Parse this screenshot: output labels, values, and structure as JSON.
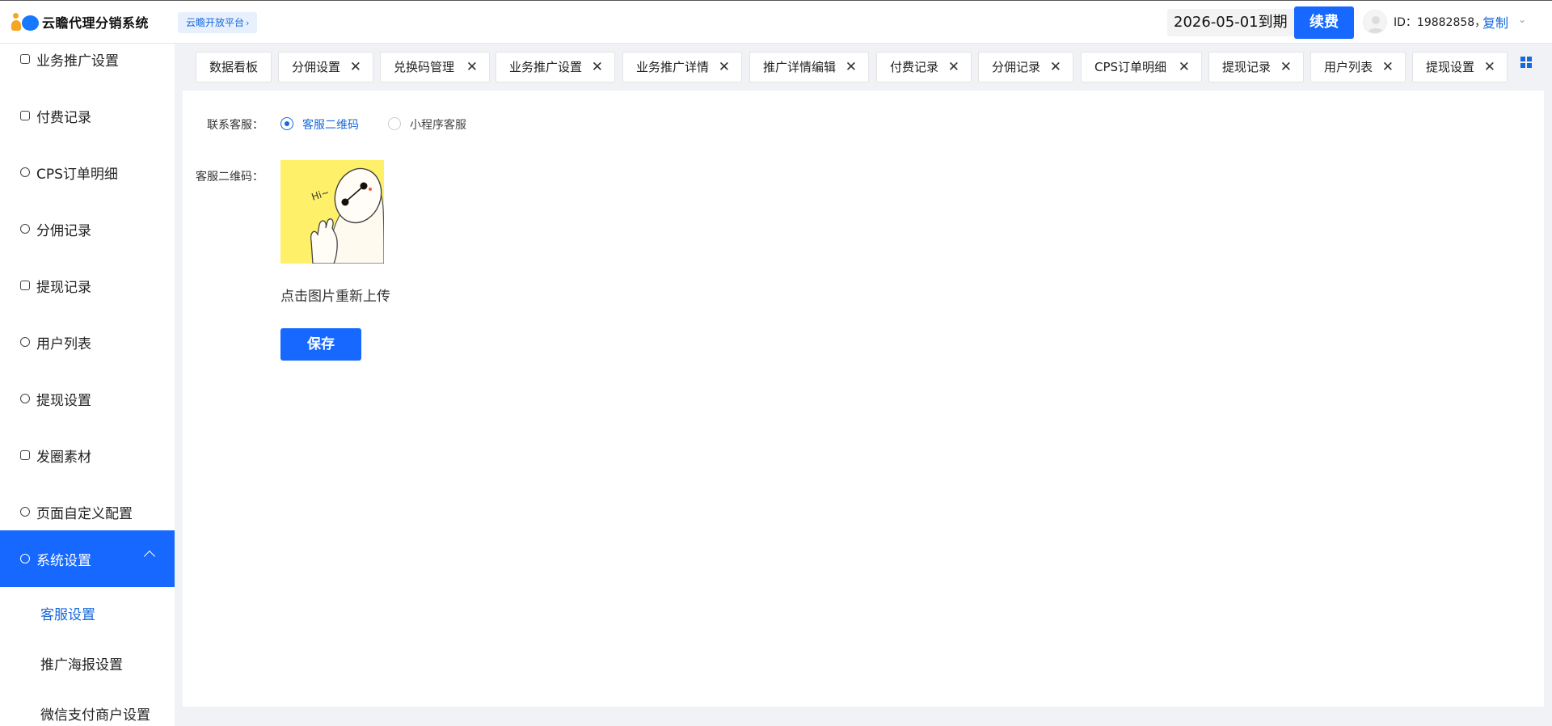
{
  "header": {
    "app_title": "云瞻代理分销系统",
    "platform_tag": "云瞻开放平台",
    "platform_chevron": "›",
    "expire_text": "2026-05-01到期",
    "renew_label": "续费",
    "uid_text": "ID：19882858，",
    "copy_label": "复制",
    "caret": "⌄"
  },
  "sidebar": {
    "items": [
      {
        "label": "业务推广设置"
      },
      {
        "label": "付费记录"
      },
      {
        "label": "CPS订单明细"
      },
      {
        "label": "分佣记录"
      },
      {
        "label": "提现记录"
      },
      {
        "label": "用户列表"
      },
      {
        "label": "提现设置"
      },
      {
        "label": "发圈素材"
      },
      {
        "label": "页面自定义配置"
      },
      {
        "label": "系统设置"
      }
    ],
    "sub_items": [
      {
        "label": "客服设置"
      },
      {
        "label": "推广海报设置"
      },
      {
        "label": "微信支付商户设置"
      }
    ]
  },
  "tabs": [
    {
      "label": "数据看板"
    },
    {
      "label": "分佣设置",
      "close": "✕"
    },
    {
      "label": "兑换码管理",
      "close": "✕"
    },
    {
      "label": "业务推广设置",
      "close": "✕"
    },
    {
      "label": "业务推广详情",
      "close": "✕"
    },
    {
      "label": "推广详情编辑",
      "close": "✕"
    },
    {
      "label": "付费记录",
      "close": "✕"
    },
    {
      "label": "分佣记录",
      "close": "✕"
    },
    {
      "label": "CPS订单明细",
      "close": "✕"
    },
    {
      "label": "提现记录",
      "close": "✕"
    },
    {
      "label": "用户列表",
      "close": "✕"
    },
    {
      "label": "提现设置",
      "close": "✕"
    }
  ],
  "form": {
    "contact_label": "联系客服：",
    "radio_qr_label": "客服二维码",
    "radio_mini_label": "小程序客服",
    "selected": "客服二维码",
    "qr_label": "客服二维码：",
    "qr_image_text": "Hi~",
    "upload_hint": "点击图片重新上传",
    "save_label": "保存"
  },
  "colors": {
    "primary": "#1668ff",
    "link": "#1668dc",
    "logo_orange": "#f5a623",
    "qr_bg": "#fff06a"
  }
}
